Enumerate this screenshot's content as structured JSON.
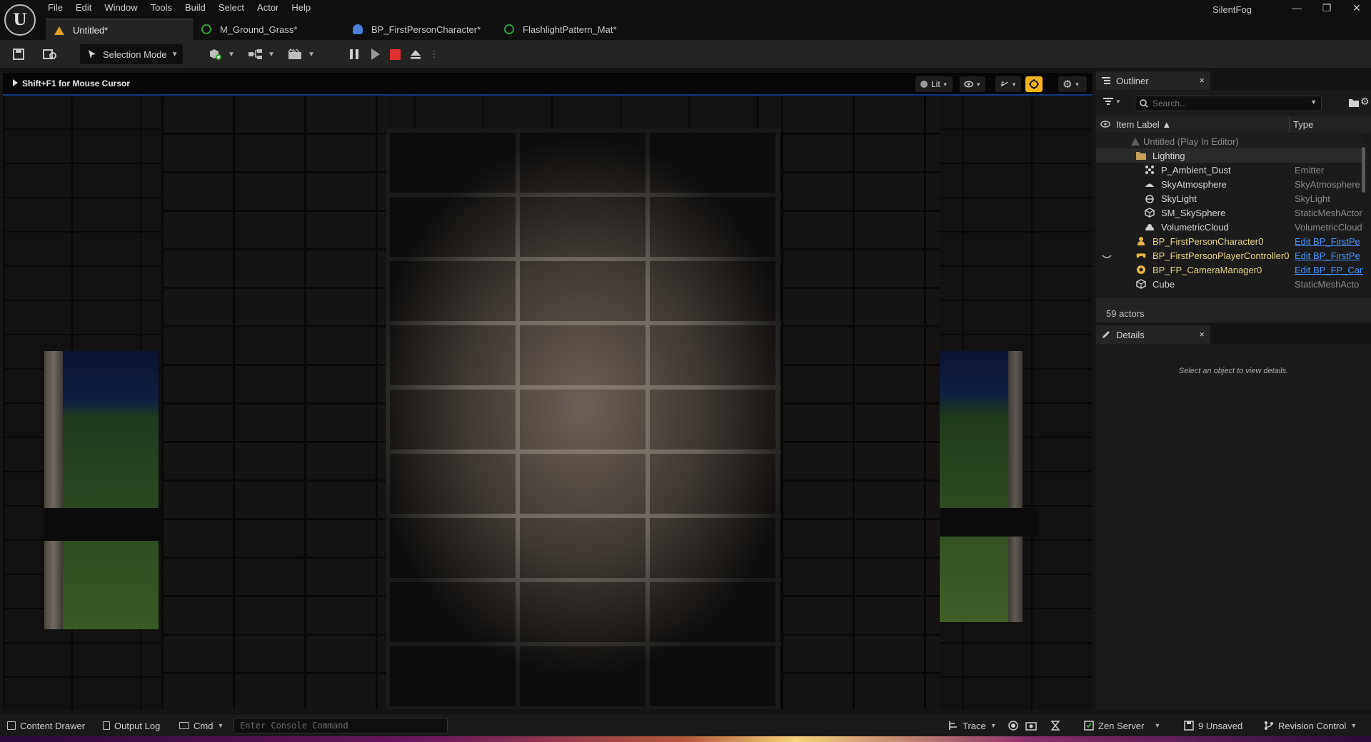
{
  "app": {
    "logo_text": "U",
    "project_name": "SilentFog",
    "menu": [
      "File",
      "Edit",
      "Window",
      "Tools",
      "Build",
      "Select",
      "Actor",
      "Help"
    ],
    "window_controls": {
      "minimize": "—",
      "restore": "❐",
      "close": "✕"
    }
  },
  "tabs": [
    {
      "label": "Untitled*",
      "icon": "level-icon",
      "active": true
    },
    {
      "label": "M_Ground_Grass*",
      "icon": "material-icon",
      "active": false
    },
    {
      "label": "BP_FirstPersonCharacter*",
      "icon": "blueprint-pawn-icon",
      "active": false
    },
    {
      "label": "FlashlightPattern_Mat*",
      "icon": "material-icon",
      "active": false
    }
  ],
  "toolbar": {
    "selection_mode": "Selection Mode",
    "play_controls": [
      "pause",
      "advance-frame",
      "stop",
      "eject"
    ]
  },
  "viewport": {
    "hint": "Shift+F1 for Mouse Cursor",
    "view_mode": "Lit",
    "accent_color": "#f3b31b",
    "selection_border_color": "#0c3a80"
  },
  "outliner": {
    "title": "Outliner",
    "close": "×",
    "search_placeholder": "Search...",
    "columns": {
      "label": "Item Label ▲",
      "type": "Type"
    },
    "rows": [
      {
        "label": "Untitled (Play In Editor)",
        "type": "",
        "icon": "level-icon",
        "indent": 0,
        "dim": true
      },
      {
        "label": "Lighting",
        "type": "",
        "icon": "folder-icon",
        "indent": 1
      },
      {
        "label": "P_Ambient_Dust",
        "type": "Emitter",
        "icon": "emitter-icon",
        "indent": 2
      },
      {
        "label": "SkyAtmosphere",
        "type": "SkyAtmosphere",
        "icon": "sky-atmosphere-icon",
        "indent": 2
      },
      {
        "label": "SkyLight",
        "type": "SkyLight",
        "icon": "skylight-icon",
        "indent": 2
      },
      {
        "label": "SM_SkySphere",
        "type": "StaticMeshActor",
        "icon": "static-mesh-icon",
        "indent": 2
      },
      {
        "label": "VolumetricCloud",
        "type": "VolumetricCloud",
        "icon": "cloud-icon",
        "indent": 2
      },
      {
        "label": "BP_FirstPersonCharacter0",
        "type": "Edit BP_FirstPe",
        "icon": "pawn-icon",
        "indent": 1,
        "link": true
      },
      {
        "label": "BP_FirstPersonPlayerController0",
        "type": "Edit BP_FirstPe",
        "icon": "controller-icon",
        "indent": 1,
        "link": true
      },
      {
        "label": "BP_FP_CameraManager0",
        "type": "Edit BP_FP_Can",
        "icon": "camera-manager-icon",
        "indent": 1,
        "link": true
      },
      {
        "label": "Cube",
        "type": "StaticMeshActo",
        "icon": "static-mesh-icon",
        "indent": 1
      }
    ],
    "actor_count": "59 actors"
  },
  "details": {
    "title": "Details",
    "close": "×",
    "empty_message": "Select an object to view details."
  },
  "statusbar": {
    "content_drawer": "Content Drawer",
    "output_log": "Output Log",
    "cmd": "Cmd",
    "console_placeholder": "Enter Console Command",
    "trace": "Trace",
    "zen_server": "Zen Server",
    "unsaved": "9 Unsaved",
    "revision_control": "Revision Control"
  }
}
